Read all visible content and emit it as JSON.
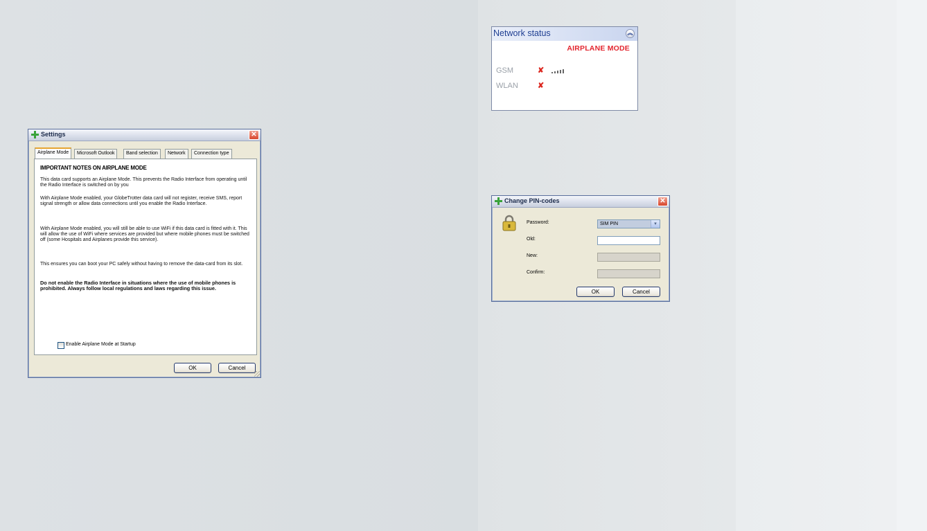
{
  "settings": {
    "title": "Settings",
    "close_glyph": "✕",
    "tabs": [
      "Airplane Mode",
      "Microsoft Outlook",
      "Band selection",
      "Network",
      "Connection type"
    ],
    "heading": "IMPORTANT NOTES ON AIRPLANE MODE",
    "paragraphs": [
      "This data card supports an Airplane Mode. This prevents the Radio Interface from operating until the Radio Interface is switched on by you",
      "With Airplane Mode enabled, your GlobeTrotter data card will not register, receive SMS, report signal strength or allow data connections until you enable the Radio Interface.",
      "With Airplane Mode enabled, you will still be able to use WiFi if this data card is fitted with it. This will allow the use of WiFi where services are provided but where mobile phones must be switched off (some Hospitals and Airplanes provide this service).",
      "This ensures you can boot your PC safely without having to remove the data-card from its slot."
    ],
    "warning": "Do not enable the Radio Interface in situations where the use of mobile phones is prohibited. Always follow local regulations and laws regarding this issue.",
    "checkbox_label": "Enable Airplane Mode at Startup",
    "checkbox_checked": false,
    "ok_label": "OK",
    "cancel_label": "Cancel"
  },
  "network_status": {
    "title": "Network status",
    "collapse_glyph": "︽",
    "mode": "AIRPLANE MODE",
    "mode_color": "#e3262f",
    "rows": [
      {
        "label": "GSM",
        "status_glyph": "✘",
        "signal_icon": "signal-bars-icon"
      },
      {
        "label": "WLAN",
        "status_glyph": "✘"
      }
    ]
  },
  "pin_dialog": {
    "title": "Change PIN-codes",
    "close_glyph": "✕",
    "password_label": "Password:",
    "password_value": "SIM PIN",
    "dropdown_glyph": "▾",
    "old_label": "Old:",
    "new_label": "New:",
    "confirm_label": "Confirm:",
    "ok_label": "OK",
    "cancel_label": "Cancel"
  }
}
